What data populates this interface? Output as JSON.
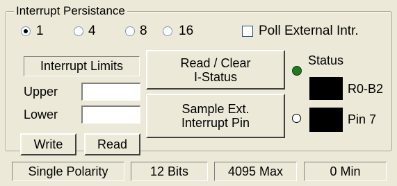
{
  "group": {
    "title": "Interrupt Persistance"
  },
  "persistence": {
    "options": [
      "1",
      "4",
      "8",
      "16"
    ],
    "selected": "1"
  },
  "poll": {
    "label": "Poll External Intr.",
    "checked": false
  },
  "limits": {
    "header": "Interrupt Limits",
    "upper_label": "Upper",
    "lower_label": "Lower",
    "upper_value": "",
    "lower_value": ""
  },
  "buttons": {
    "read_clear_line1": "Read / Clear",
    "read_clear_line2": "I-Status",
    "sample_line1": "Sample  Ext.",
    "sample_line2": "Interrupt Pin",
    "write": "Write",
    "read": "Read"
  },
  "status": {
    "label": "Status",
    "indicator1_label": "R0-B2",
    "indicator2_label": "Pin 7",
    "led_status_color": "#1e7b1e",
    "led_pin_color": "#ffffff"
  },
  "statusbar": {
    "polarity": "Single Polarity",
    "bits": "12 Bits",
    "max": "4095 Max",
    "min": "0 Min"
  }
}
